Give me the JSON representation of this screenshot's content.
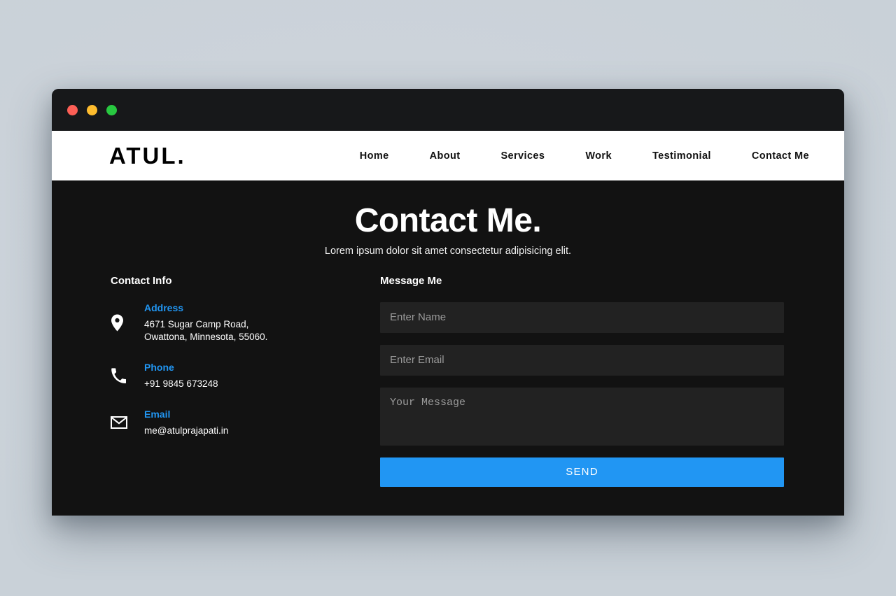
{
  "window": {
    "traffic_lights": [
      {
        "name": "close",
        "color": "#fd5f56"
      },
      {
        "name": "minimize",
        "color": "#febc2e"
      },
      {
        "name": "maximize",
        "color": "#28c840"
      }
    ]
  },
  "navbar": {
    "logo": "ATUL.",
    "links": [
      {
        "label": "Home"
      },
      {
        "label": "About"
      },
      {
        "label": "Services"
      },
      {
        "label": "Work"
      },
      {
        "label": "Testimonial"
      },
      {
        "label": "Contact Me"
      }
    ]
  },
  "hero": {
    "title": "Contact Me.",
    "subtitle": "Lorem ipsum dolor sit amet consectetur adipisicing elit."
  },
  "contact_info": {
    "heading": "Contact Info",
    "items": [
      {
        "icon": "location-pin-icon",
        "label": "Address",
        "line1": "4671 Sugar Camp Road,",
        "line2": "Owattona, Minnesota, 55060."
      },
      {
        "icon": "phone-icon",
        "label": "Phone",
        "line1": "+91 9845 673248",
        "line2": ""
      },
      {
        "icon": "envelope-icon",
        "label": "Email",
        "line1": "me@atulprajapati.in",
        "line2": ""
      }
    ]
  },
  "message_form": {
    "heading": "Message Me",
    "name_placeholder": "Enter Name",
    "name_value": "",
    "email_placeholder": "Enter Email",
    "email_value": "",
    "message_placeholder": "Your Message",
    "message_value": "",
    "submit_label": "SEND"
  },
  "colors": {
    "accent_blue": "#2196f3",
    "page_background": "#121212",
    "navbar_background": "#ffffff",
    "field_background": "#222222",
    "desktop_background": "#ccd3da"
  }
}
